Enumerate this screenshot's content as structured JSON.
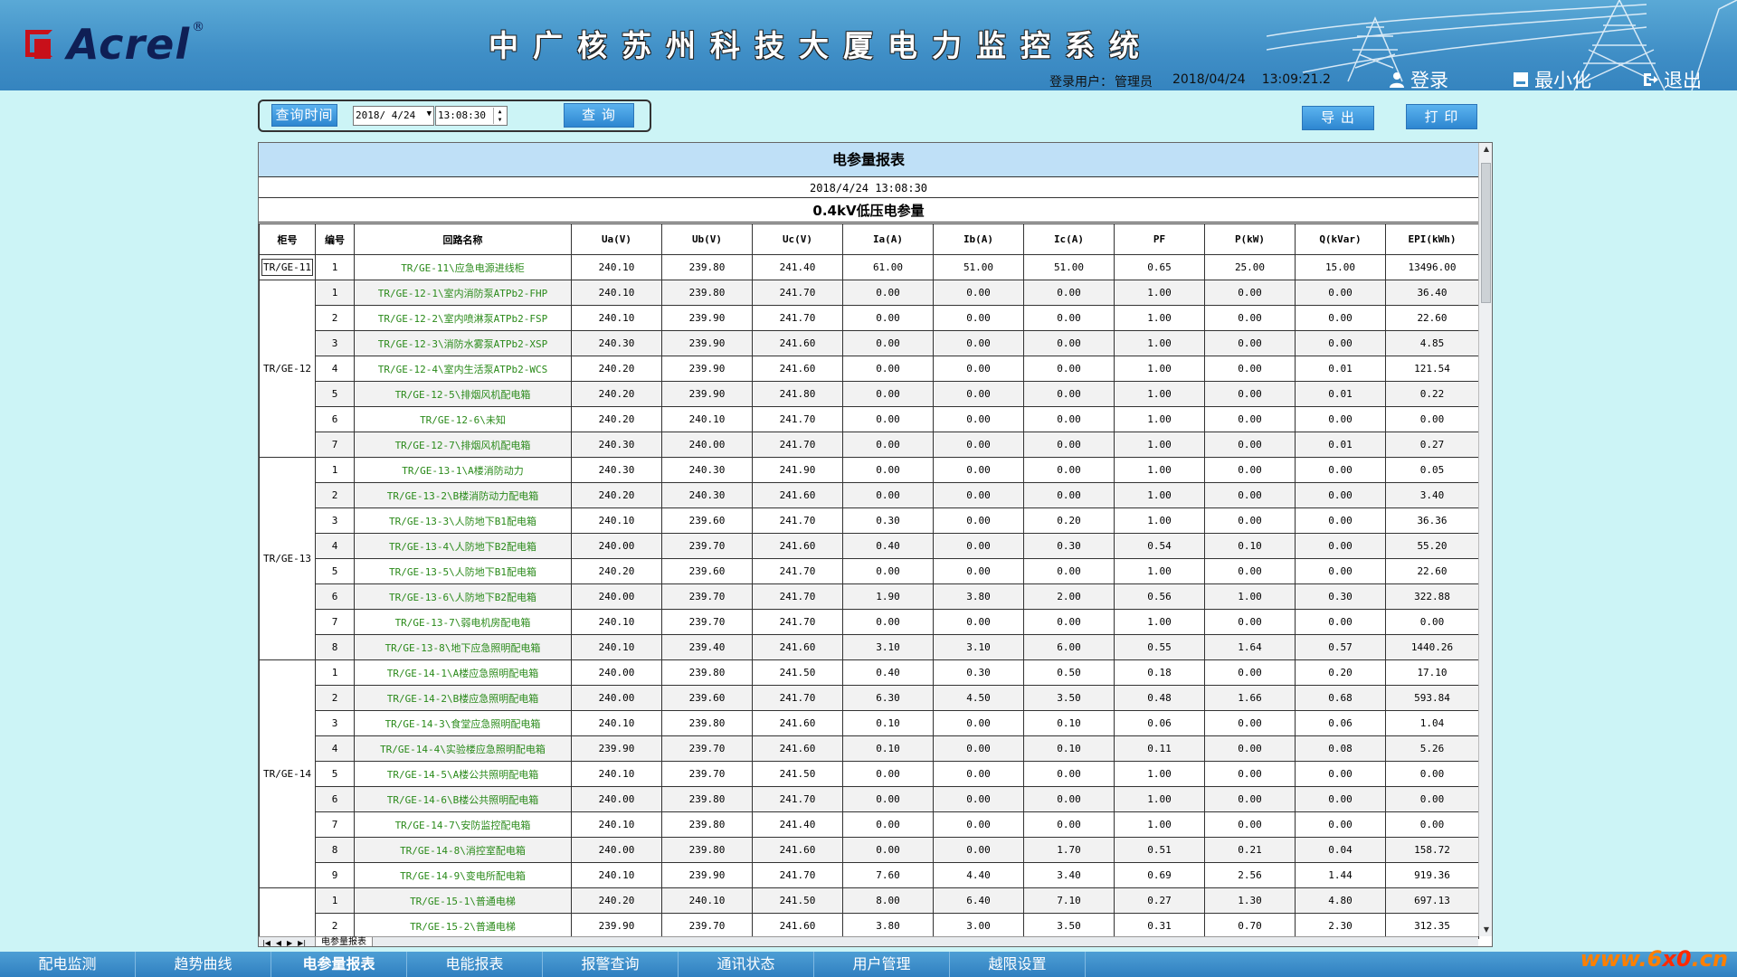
{
  "header": {
    "brand": "Acrel",
    "reg_mark": "®",
    "title": "中广核苏州科技大厦电力监控系统",
    "user_label": "登录用户：",
    "user_name": "管理员",
    "date": "2018/04/24",
    "time": "13:09:21.2",
    "login_label": "登录",
    "minimize_label": "最小化",
    "exit_label": "退出"
  },
  "query": {
    "query_time_label": "查询时间",
    "date_value": "2018/ 4/24",
    "time_value": "13:08:30",
    "query_button": "查 询",
    "export_button": "导 出",
    "print_button": "打 印"
  },
  "report": {
    "title": "电参量报表",
    "datetime": "2018/4/24 13:08:30",
    "subtitle": "0.4kV低压电参量",
    "columns": [
      "柜号",
      "编号",
      "回路名称",
      "Ua(V)",
      "Ub(V)",
      "Uc(V)",
      "Ia(A)",
      "Ib(A)",
      "Ic(A)",
      "PF",
      "P(kW)",
      "Q(kVar)",
      "EPI(kWh)"
    ],
    "groups": [
      {
        "cabinet": "TR/GE-11",
        "rows": [
          [
            "1",
            "TR/GE-11\\应急电源进线柜",
            "240.10",
            "239.80",
            "241.40",
            "61.00",
            "51.00",
            "51.00",
            "0.65",
            "25.00",
            "15.00",
            "13496.00"
          ]
        ]
      },
      {
        "cabinet": "TR/GE-12",
        "rows": [
          [
            "1",
            "TR/GE-12-1\\室内消防泵ATPb2-FHP",
            "240.10",
            "239.80",
            "241.70",
            "0.00",
            "0.00",
            "0.00",
            "1.00",
            "0.00",
            "0.00",
            "36.40"
          ],
          [
            "2",
            "TR/GE-12-2\\室内喷淋泵ATPb2-FSP",
            "240.10",
            "239.90",
            "241.70",
            "0.00",
            "0.00",
            "0.00",
            "1.00",
            "0.00",
            "0.00",
            "22.60"
          ],
          [
            "3",
            "TR/GE-12-3\\消防水雾泵ATPb2-XSP",
            "240.30",
            "239.90",
            "241.60",
            "0.00",
            "0.00",
            "0.00",
            "1.00",
            "0.00",
            "0.00",
            "4.85"
          ],
          [
            "4",
            "TR/GE-12-4\\室内生活泵ATPb2-WCS",
            "240.20",
            "239.90",
            "241.60",
            "0.00",
            "0.00",
            "0.00",
            "1.00",
            "0.00",
            "0.01",
            "121.54"
          ],
          [
            "5",
            "TR/GE-12-5\\排烟风机配电箱",
            "240.20",
            "239.90",
            "241.80",
            "0.00",
            "0.00",
            "0.00",
            "1.00",
            "0.00",
            "0.01",
            "0.22"
          ],
          [
            "6",
            "TR/GE-12-6\\未知",
            "240.20",
            "240.10",
            "241.70",
            "0.00",
            "0.00",
            "0.00",
            "1.00",
            "0.00",
            "0.00",
            "0.00"
          ],
          [
            "7",
            "TR/GE-12-7\\排烟风机配电箱",
            "240.30",
            "240.00",
            "241.70",
            "0.00",
            "0.00",
            "0.00",
            "1.00",
            "0.00",
            "0.01",
            "0.27"
          ]
        ]
      },
      {
        "cabinet": "TR/GE-13",
        "rows": [
          [
            "1",
            "TR/GE-13-1\\A楼消防动力",
            "240.30",
            "240.30",
            "241.90",
            "0.00",
            "0.00",
            "0.00",
            "1.00",
            "0.00",
            "0.00",
            "0.05"
          ],
          [
            "2",
            "TR/GE-13-2\\B楼消防动力配电箱",
            "240.20",
            "240.30",
            "241.60",
            "0.00",
            "0.00",
            "0.00",
            "1.00",
            "0.00",
            "0.00",
            "3.40"
          ],
          [
            "3",
            "TR/GE-13-3\\人防地下B1配电箱",
            "240.10",
            "239.60",
            "241.70",
            "0.30",
            "0.00",
            "0.20",
            "1.00",
            "0.00",
            "0.00",
            "36.36"
          ],
          [
            "4",
            "TR/GE-13-4\\人防地下B2配电箱",
            "240.00",
            "239.70",
            "241.60",
            "0.40",
            "0.00",
            "0.30",
            "0.54",
            "0.10",
            "0.00",
            "55.20"
          ],
          [
            "5",
            "TR/GE-13-5\\人防地下B1配电箱",
            "240.20",
            "239.60",
            "241.70",
            "0.00",
            "0.00",
            "0.00",
            "1.00",
            "0.00",
            "0.00",
            "22.60"
          ],
          [
            "6",
            "TR/GE-13-6\\人防地下B2配电箱",
            "240.00",
            "239.70",
            "241.70",
            "1.90",
            "3.80",
            "2.00",
            "0.56",
            "1.00",
            "0.30",
            "322.88"
          ],
          [
            "7",
            "TR/GE-13-7\\弱电机房配电箱",
            "240.10",
            "239.70",
            "241.70",
            "0.00",
            "0.00",
            "0.00",
            "1.00",
            "0.00",
            "0.00",
            "0.00"
          ],
          [
            "8",
            "TR/GE-13-8\\地下应急照明配电箱",
            "240.10",
            "239.40",
            "241.60",
            "3.10",
            "3.10",
            "6.00",
            "0.55",
            "1.64",
            "0.57",
            "1440.26"
          ]
        ]
      },
      {
        "cabinet": "TR/GE-14",
        "rows": [
          [
            "1",
            "TR/GE-14-1\\A楼应急照明配电箱",
            "240.00",
            "239.80",
            "241.50",
            "0.40",
            "0.30",
            "0.50",
            "0.18",
            "0.00",
            "0.20",
            "17.10"
          ],
          [
            "2",
            "TR/GE-14-2\\B楼应急照明配电箱",
            "240.00",
            "239.60",
            "241.70",
            "6.30",
            "4.50",
            "3.50",
            "0.48",
            "1.66",
            "0.68",
            "593.84"
          ],
          [
            "3",
            "TR/GE-14-3\\食堂应急照明配电箱",
            "240.10",
            "239.80",
            "241.60",
            "0.10",
            "0.00",
            "0.10",
            "0.06",
            "0.00",
            "0.06",
            "1.04"
          ],
          [
            "4",
            "TR/GE-14-4\\实验楼应急照明配电箱",
            "239.90",
            "239.70",
            "241.60",
            "0.10",
            "0.00",
            "0.10",
            "0.11",
            "0.00",
            "0.08",
            "5.26"
          ],
          [
            "5",
            "TR/GE-14-5\\A楼公共照明配电箱",
            "240.10",
            "239.70",
            "241.50",
            "0.00",
            "0.00",
            "0.00",
            "1.00",
            "0.00",
            "0.00",
            "0.00"
          ],
          [
            "6",
            "TR/GE-14-6\\B楼公共照明配电箱",
            "240.00",
            "239.80",
            "241.70",
            "0.00",
            "0.00",
            "0.00",
            "1.00",
            "0.00",
            "0.00",
            "0.00"
          ],
          [
            "7",
            "TR/GE-14-7\\安防监控配电箱",
            "240.10",
            "239.80",
            "241.40",
            "0.00",
            "0.00",
            "0.00",
            "1.00",
            "0.00",
            "0.00",
            "0.00"
          ],
          [
            "8",
            "TR/GE-14-8\\消控室配电箱",
            "240.00",
            "239.80",
            "241.60",
            "0.00",
            "0.00",
            "1.70",
            "0.51",
            "0.21",
            "0.04",
            "158.72"
          ],
          [
            "9",
            "TR/GE-14-9\\变电所配电箱",
            "240.10",
            "239.90",
            "241.70",
            "7.60",
            "4.40",
            "3.40",
            "0.69",
            "2.56",
            "1.44",
            "919.36"
          ]
        ]
      },
      {
        "cabinet": "",
        "rows": [
          [
            "1",
            "TR/GE-15-1\\普通电梯",
            "240.20",
            "240.10",
            "241.50",
            "8.00",
            "6.40",
            "7.10",
            "0.27",
            "1.30",
            "4.80",
            "697.13"
          ],
          [
            "2",
            "TR/GE-15-2\\普通电梯",
            "239.90",
            "239.70",
            "241.60",
            "3.80",
            "3.00",
            "3.50",
            "0.31",
            "0.70",
            "2.30",
            "312.35"
          ]
        ]
      }
    ],
    "sheet_tab": "电参量报表"
  },
  "nav": {
    "items": [
      "配电监测",
      "趋势曲线",
      "电参量报表",
      "电能报表",
      "报警查询",
      "通讯状态",
      "用户管理",
      "越限设置"
    ],
    "active_index": 2
  },
  "watermark": {
    "pre": "www.6",
    "x0": "x0",
    "post": ".cn"
  }
}
